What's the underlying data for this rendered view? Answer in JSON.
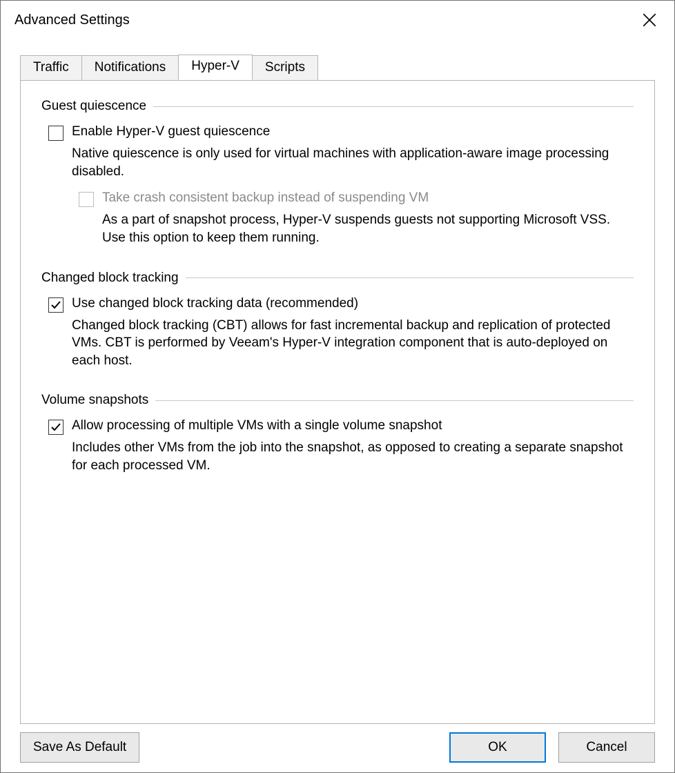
{
  "window": {
    "title": "Advanced Settings"
  },
  "tabs": {
    "traffic": "Traffic",
    "notifications": "Notifications",
    "hyperv": "Hyper-V",
    "scripts": "Scripts",
    "active": "hyperv"
  },
  "groups": {
    "quiescence": {
      "title": "Guest quiescence",
      "enable": {
        "label": "Enable Hyper-V guest quiescence",
        "checked": false,
        "desc": "Native quiescence is only used for virtual machines with application-aware image processing disabled."
      },
      "crash": {
        "label": "Take crash consistent backup instead of suspending VM",
        "checked": false,
        "disabled": true,
        "desc": "As a part of snapshot process, Hyper-V suspends guests not supporting Microsoft VSS. Use this option to keep them running."
      }
    },
    "cbt": {
      "title": "Changed block tracking",
      "use": {
        "label": "Use changed block tracking data (recommended)",
        "checked": true,
        "desc": "Changed block tracking (CBT) allows for fast incremental backup and replication of protected VMs. CBT is performed by Veeam's Hyper-V integration component that is auto-deployed on each host."
      }
    },
    "snapshots": {
      "title": "Volume snapshots",
      "allow": {
        "label": "Allow processing of multiple VMs with a single volume snapshot",
        "checked": true,
        "desc": "Includes other VMs from the job into the snapshot, as opposed to creating a separate snapshot for each processed VM."
      }
    }
  },
  "buttons": {
    "save_default": "Save As Default",
    "ok": "OK",
    "cancel": "Cancel"
  }
}
